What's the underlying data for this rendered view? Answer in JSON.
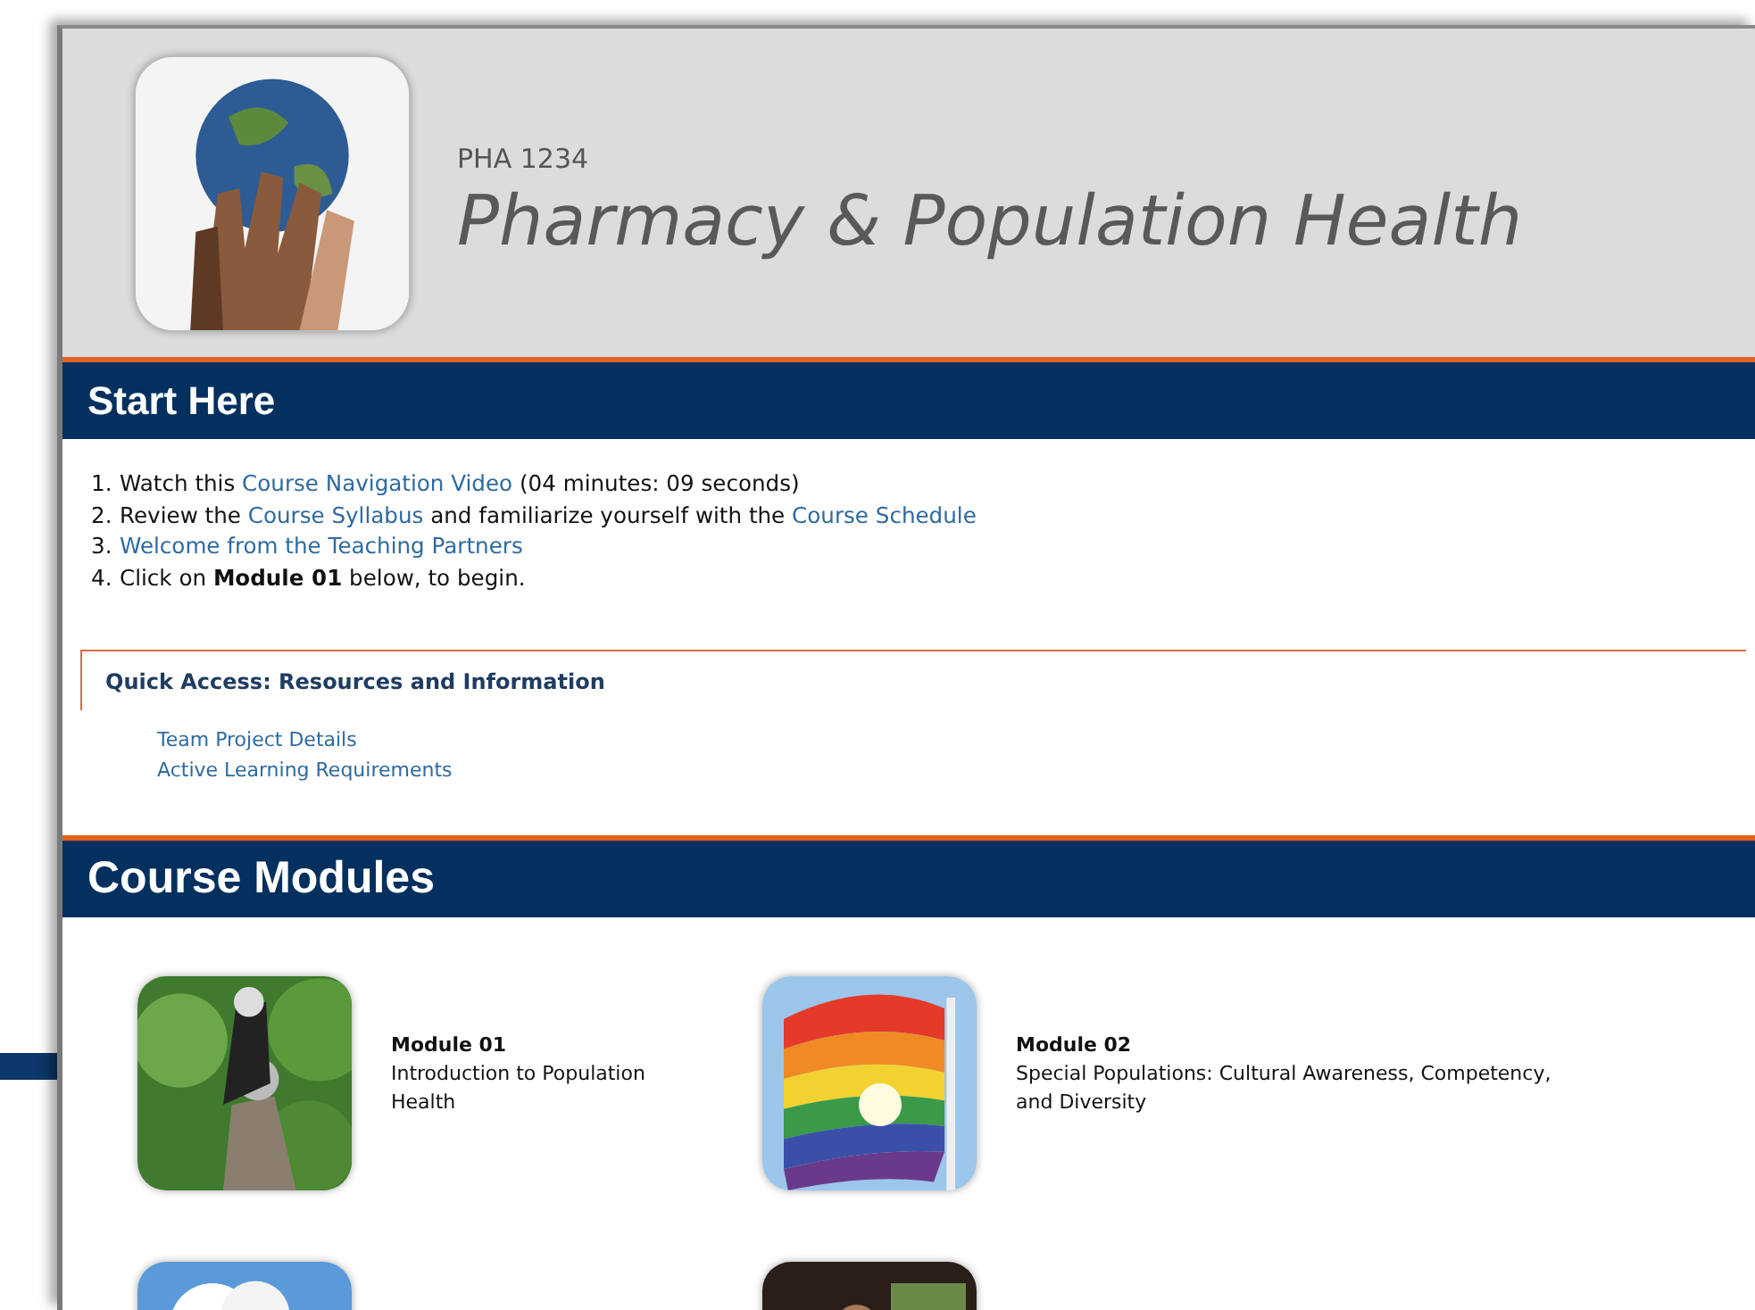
{
  "header": {
    "course_code": "PHA 1234",
    "course_title": "Pharmacy & Population Health"
  },
  "start_here": {
    "heading": "Start Here",
    "steps": [
      {
        "number": "1.",
        "parts": [
          {
            "kind": "text",
            "text": "Watch this "
          },
          {
            "kind": "link",
            "text": "Course Navigation Video"
          },
          {
            "kind": "text",
            "text": " (04 minutes: 09 seconds)"
          }
        ]
      },
      {
        "number": "2.",
        "parts": [
          {
            "kind": "text",
            "text": "Review the "
          },
          {
            "kind": "link",
            "text": "Course Syllabus"
          },
          {
            "kind": "text",
            "text": " and familiarize yourself with the "
          },
          {
            "kind": "link",
            "text": "Course Schedule"
          }
        ]
      },
      {
        "number": "3.",
        "parts": [
          {
            "kind": "link",
            "text": "Welcome from the Teaching Partners"
          }
        ]
      },
      {
        "number": "4.",
        "parts": [
          {
            "kind": "text",
            "text": "Click on **Module 01** below, to begin."
          }
        ]
      }
    ]
  },
  "quick_access": {
    "heading": "Quick Access: Resources and Information",
    "links": [
      "Team Project Details",
      "Active Learning Requirements"
    ]
  },
  "course_modules": {
    "heading": "Course Modules",
    "modules": [
      {
        "kind": "module",
        "title": "Module 01",
        "description": "Introduction to Population Health"
      },
      {
        "kind": "module",
        "title": "Module 02",
        "description": "Special Populations: Cultural Awareness, Competency, and Diversity"
      },
      {
        "kind": "picture"
      },
      {
        "kind": "picture"
      }
    ]
  }
}
